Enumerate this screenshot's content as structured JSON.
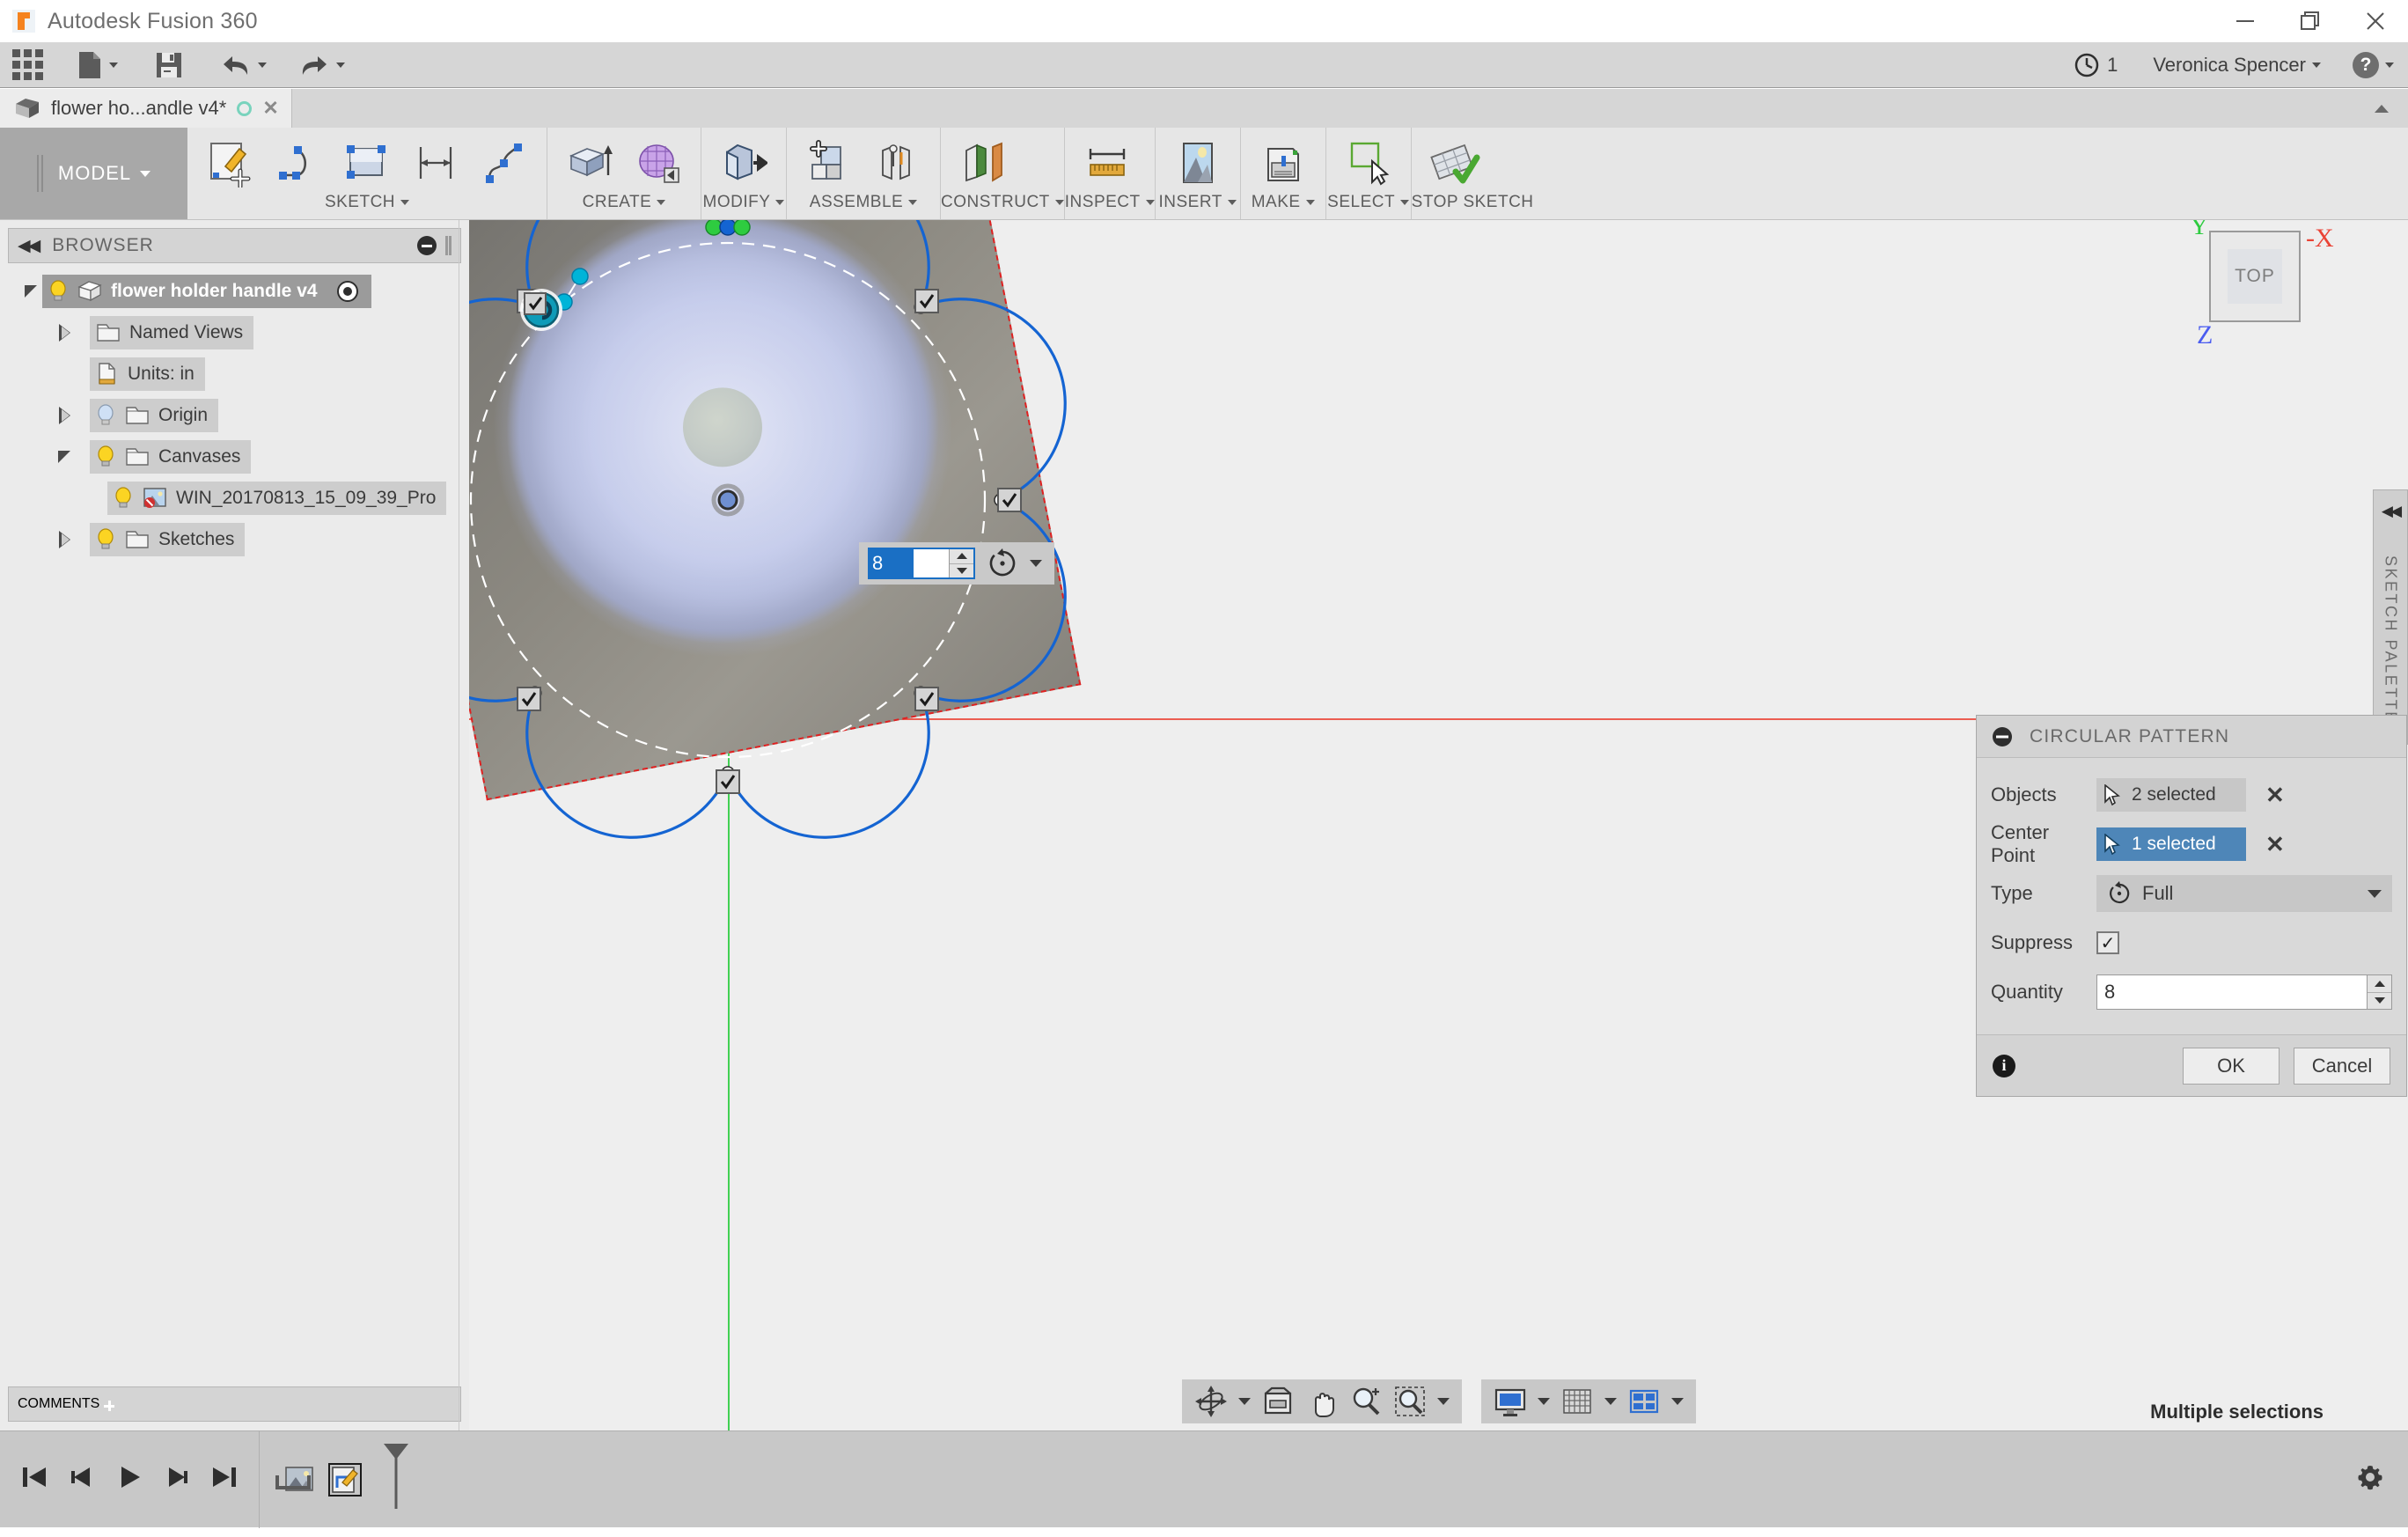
{
  "app": {
    "title": "Autodesk Fusion 360",
    "window_controls": [
      "minimize",
      "restore",
      "close"
    ]
  },
  "quick_access": {
    "items": [
      {
        "name": "app-grid",
        "label": ""
      },
      {
        "name": "new-file",
        "label": ""
      },
      {
        "name": "save",
        "label": ""
      },
      {
        "name": "undo",
        "label": ""
      },
      {
        "name": "redo",
        "label": ""
      }
    ],
    "job_count": "1",
    "user": "Veronica Spencer",
    "help_label": "?"
  },
  "document_tab": {
    "label": "flower ho...andle v4*",
    "has_unsaved_indicator": true,
    "close_label": "✕"
  },
  "ribbon": {
    "workspace": "MODEL",
    "groups": [
      {
        "label": "SKETCH",
        "has_caret": true,
        "tools": [
          "create-sketch-icon",
          "arc-icon",
          "rectangle-icon",
          "sketch-dimension-icon",
          "spline-icon"
        ]
      },
      {
        "label": "CREATE",
        "has_caret": true,
        "tools": [
          "extrude-icon",
          "create-form-icon"
        ]
      },
      {
        "label": "MODIFY",
        "has_caret": true,
        "tools": [
          "press-pull-icon"
        ]
      },
      {
        "label": "ASSEMBLE",
        "has_caret": true,
        "tools": [
          "new-component-icon",
          "joint-icon"
        ]
      },
      {
        "label": "CONSTRUCT",
        "has_caret": true,
        "tools": [
          "offset-plane-icon"
        ]
      },
      {
        "label": "INSPECT",
        "has_caret": true,
        "tools": [
          "measure-icon"
        ]
      },
      {
        "label": "INSERT",
        "has_caret": true,
        "tools": [
          "insert-canvas-icon"
        ]
      },
      {
        "label": "MAKE",
        "has_caret": true,
        "tools": [
          "3d-print-icon"
        ]
      },
      {
        "label": "SELECT",
        "has_caret": true,
        "tools": [
          "select-icon"
        ]
      },
      {
        "label": "STOP SKETCH",
        "has_caret": false,
        "tools": [
          "stop-sketch-icon"
        ]
      }
    ]
  },
  "browser": {
    "title": "BROWSER",
    "collapse_label": "◀◀",
    "nodes": [
      {
        "label": "flower holder handle v4",
        "depth": 0,
        "twisty": "down",
        "bulb": "on",
        "icon": "component-icon",
        "selected": true,
        "trailing": "activate-radio-icon"
      },
      {
        "label": "Named Views",
        "depth": 1,
        "twisty": "right",
        "bulb": "none",
        "icon": "folder-icon",
        "selected": false
      },
      {
        "label": "Units: in",
        "depth": 1,
        "twisty": "none",
        "bulb": "none",
        "icon": "units-icon",
        "selected": false
      },
      {
        "label": "Origin",
        "depth": 1,
        "twisty": "right",
        "bulb": "off",
        "icon": "folder-icon",
        "selected": false
      },
      {
        "label": "Canvases",
        "depth": 1,
        "twisty": "down",
        "bulb": "on",
        "icon": "folder-icon",
        "selected": false
      },
      {
        "label": "WIN_20170813_15_09_39_Pro",
        "depth": 2,
        "twisty": "none",
        "bulb": "on",
        "icon": "canvas-image-icon",
        "selected": false
      },
      {
        "label": "Sketches",
        "depth": 1,
        "twisty": "right",
        "bulb": "on",
        "icon": "folder-icon",
        "selected": false
      }
    ]
  },
  "comments": {
    "title": "COMMENTS",
    "add_label": "+"
  },
  "canvas": {
    "view_cube": {
      "face_label": "TOP",
      "axis_labels": {
        "y": "Y",
        "x": "-X",
        "z": "Z"
      },
      "axis_colors": {
        "y": "#2ecc40",
        "x": "#ea4335",
        "z": "#4a5cf0"
      }
    },
    "sketch_palette_tab": {
      "label": "SKETCH PALETTE",
      "collapse_label": "◀◀"
    },
    "quantity_widget": {
      "value": "8",
      "mode_icon": "circular-pattern-icon"
    },
    "navigation_bar": {
      "group_one": [
        "orbit-icon",
        "look-at-icon",
        "pan-icon",
        "zoom-icon",
        "zoom-window-icon"
      ],
      "group_two": [
        "display-settings-icon",
        "grid-snap-icon",
        "viewports-icon"
      ]
    },
    "overlay": {
      "canvas_image_name": "WIN_20170813_15_09_39_Pro",
      "plane_border_color": "#e02020",
      "profile_color": "#1464d2",
      "construction_color": "#ffffff",
      "selected_color": "#00b4d8",
      "coincident_color": "#2ecc40"
    }
  },
  "circular_pattern_dialog": {
    "title": "CIRCULAR PATTERN",
    "collapse_icon": "minus-circle-icon",
    "rows": [
      {
        "label": "Objects",
        "control": "selection",
        "value": "2 selected",
        "active": false,
        "clear": "✕"
      },
      {
        "label": "Center Point",
        "control": "selection",
        "value": "1 selected",
        "active": true,
        "clear": "✕"
      },
      {
        "label": "Type",
        "control": "dropdown",
        "value": "Full"
      },
      {
        "label": "Suppress",
        "control": "checkbox",
        "value": "✓",
        "checked": true
      },
      {
        "label": "Quantity",
        "control": "number",
        "value": "8"
      }
    ],
    "info_icon": "info-icon",
    "ok_label": "OK",
    "cancel_label": "Cancel"
  },
  "status": {
    "message": "Multiple selections"
  },
  "timeline": {
    "playback": [
      "go-to-beginning-icon",
      "step-back-icon",
      "play-icon",
      "step-forward-icon",
      "go-to-end-icon"
    ],
    "nodes": [
      {
        "name": "canvas-feature-node",
        "selected": false
      },
      {
        "name": "sketch-feature-node",
        "selected": true
      }
    ],
    "settings_icon": "gear-icon"
  }
}
